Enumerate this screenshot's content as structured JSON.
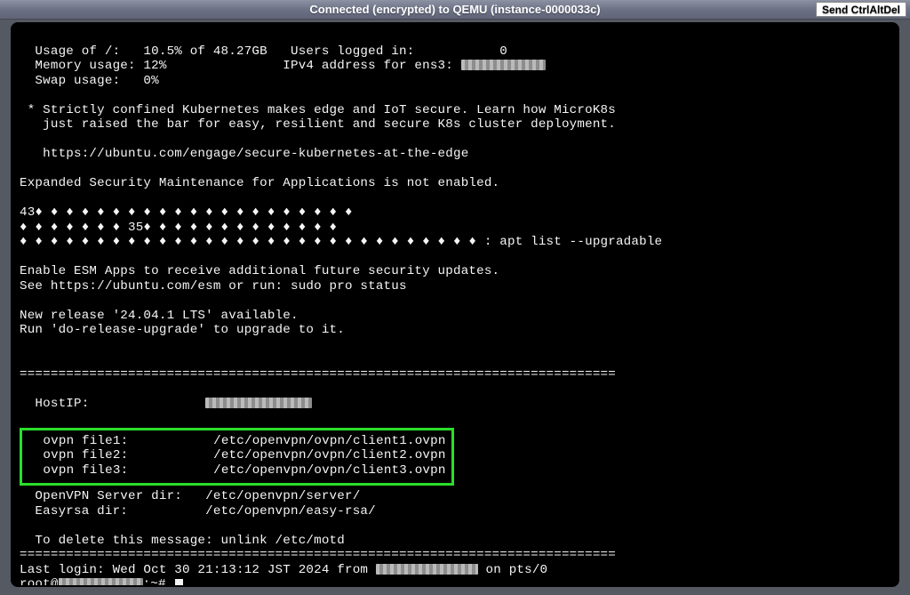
{
  "titlebar": {
    "title": "Connected (encrypted) to QEMU (instance-0000033c)",
    "button": "Send CtrlAltDel"
  },
  "motd": {
    "usage_line": "  Usage of /:   10.5% of 48.27GB   Users logged in:           0",
    "memory_line_prefix": "  Memory usage: 12%               IPv4 address for ens3: ",
    "swap_line": "  Swap usage:   0%",
    "promo1": " * Strictly confined Kubernetes makes edge and IoT secure. Learn how MicroK8s",
    "promo2": "   just raised the bar for easy, resilient and secure K8s cluster deployment.",
    "promo_url": "   https://ubuntu.com/engage/secure-kubernetes-at-the-edge",
    "esm_not_enabled": "Expanded Security Maintenance for Applications is not enabled.",
    "diamonds1": "43♦ ♦ ♦ ♦ ♦ ♦ ♦ ♦ ♦ ♦ ♦ ♦ ♦ ♦ ♦ ♦ ♦ ♦ ♦ ♦ ♦",
    "diamonds2": "♦ ♦ ♦ ♦ ♦ ♦ ♦ 35♦ ♦ ♦ ♦ ♦ ♦ ♦ ♦ ♦ ♦ ♦ ♦ ♦",
    "diamonds3": "♦ ♦ ♦ ♦ ♦ ♦ ♦ ♦ ♦ ♦ ♦ ♦ ♦ ♦ ♦ ♦ ♦ ♦ ♦ ♦ ♦ ♦ ♦ ♦ ♦ ♦ ♦ ♦ ♦ ♦ : apt list --upgradable",
    "esm_enable1": "Enable ESM Apps to receive additional future security updates.",
    "esm_enable2": "See https://ubuntu.com/esm or run: sudo pro status",
    "newrelease1": "New release '24.04.1 LTS' available.",
    "newrelease2": "Run 'do-release-upgrade' to upgrade to it.",
    "sep": "=============================================================================",
    "hostip_label": "  HostIP:               ",
    "ovpn1": "  ovpn file1:           /etc/openvpn/ovpn/client1.ovpn",
    "ovpn2": "  ovpn file2:           /etc/openvpn/ovpn/client2.ovpn",
    "ovpn3": "  ovpn file3:           /etc/openvpn/ovpn/client3.ovpn",
    "serverdir": "  OpenVPN Server dir:   /etc/openvpn/server/",
    "easyrsa": "  Easyrsa dir:          /etc/openvpn/easy-rsa/",
    "delete_msg": "  To delete this message: unlink /etc/motd",
    "lastlogin_pre": "Last login: Wed Oct 30 21:13:12 JST 2024 from ",
    "lastlogin_post": " on pts/0",
    "prompt_pre": "root@",
    "prompt_post": ":~# "
  }
}
